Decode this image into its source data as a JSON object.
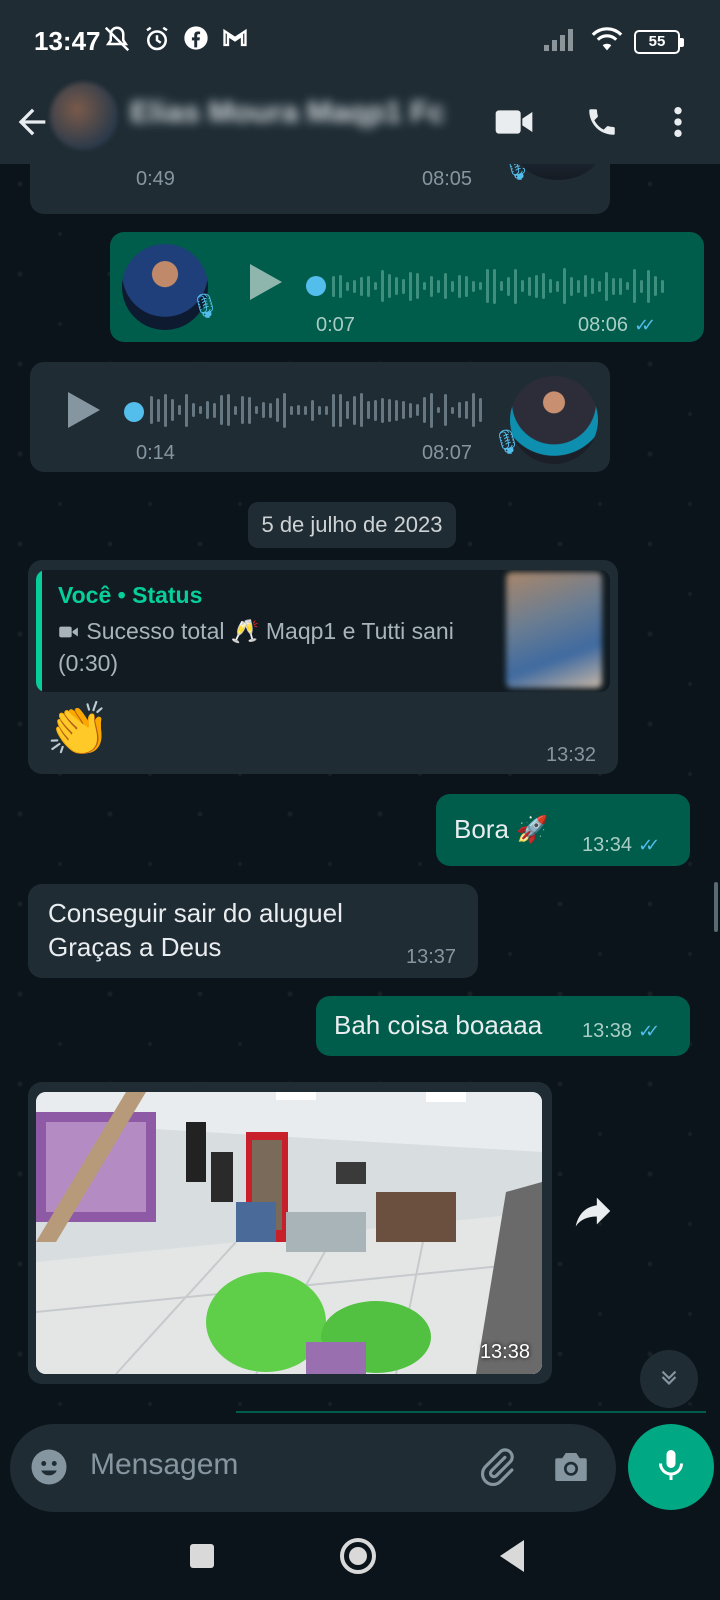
{
  "status_bar": {
    "time": "13:47",
    "battery": "55",
    "icons_left": [
      "mute-bell-icon",
      "alarm-icon",
      "facebook-icon",
      "gmail-icon"
    ],
    "icons_right": [
      "signal-icon",
      "wifi-icon",
      "battery-icon"
    ]
  },
  "header": {
    "contact_name": "Elias Moura Maqp1 Fc",
    "icons": [
      "back-arrow-icon",
      "video-call-icon",
      "voice-call-icon",
      "more-options-icon"
    ]
  },
  "messages": {
    "voice1": {
      "duration": "0:49",
      "time": "08:05"
    },
    "voice2": {
      "duration": "0:07",
      "time": "08:06",
      "ticks": "✓✓"
    },
    "voice3": {
      "duration": "0:14",
      "time": "08:07"
    },
    "date_chip": "5 de julho de 2023",
    "status_reply": {
      "title": "Você • Status",
      "body": "Sucesso total 🥂 Maqp1 e Tutti sani (0:30)",
      "emoji": "👏",
      "time": "13:32"
    },
    "bora": {
      "text": "Bora 🚀",
      "time": "13:34",
      "ticks": "✓✓"
    },
    "aluguel": {
      "line1": "Conseguir sair do aluguel",
      "line2": "Graças a Deus",
      "time": "13:37"
    },
    "bah": {
      "text": "Bah coisa boaaaa",
      "time": "13:38",
      "ticks": "✓✓"
    },
    "photo": {
      "time": "13:38"
    }
  },
  "input": {
    "placeholder": "Mensagem"
  },
  "colors": {
    "background": "#0b141a",
    "incoming_bubble": "#1f2c34",
    "outgoing_bubble": "#005c4b",
    "accent": "#00a884",
    "read_tick": "#53bdeb"
  }
}
